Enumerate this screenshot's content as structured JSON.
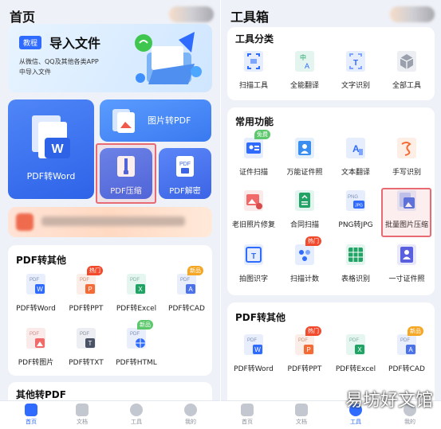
{
  "left": {
    "title": "首页",
    "banner": {
      "tag": "教程",
      "title": "导入文件",
      "line1": "从微信、QQ及其他各类APP",
      "line2": "中导入文件"
    },
    "big_tiles": {
      "pdf_word": "PDF转Word",
      "img_pdf": "图片转PDF",
      "pdf_compress": "PDF压缩",
      "pdf_decrypt": "PDF解密"
    },
    "section_title": "PDF转其他",
    "items": [
      {
        "label": "PDF转Word",
        "icon": "pdf-word-icon",
        "badge": ""
      },
      {
        "label": "PDF转PPT",
        "icon": "pdf-ppt-icon",
        "badge": "热门"
      },
      {
        "label": "PDF转Excel",
        "icon": "pdf-excel-icon",
        "badge": ""
      },
      {
        "label": "PDF转CAD",
        "icon": "pdf-cad-icon",
        "badge": "新品"
      },
      {
        "label": "PDF转图片",
        "icon": "pdf-image-icon",
        "badge": ""
      },
      {
        "label": "PDF转TXT",
        "icon": "pdf-txt-icon",
        "badge": ""
      },
      {
        "label": "PDF转HTML",
        "icon": "pdf-html-icon",
        "badge": "新品"
      }
    ],
    "next_section_title": "其他转PDF",
    "nav": [
      "首页",
      "文档",
      "工具",
      "我的"
    ]
  },
  "right": {
    "title": "工具箱",
    "cat_title": "工具分类",
    "cats": [
      {
        "label": "扫描工具",
        "icon": "scan-icon"
      },
      {
        "label": "全能翻译",
        "icon": "translate-icon"
      },
      {
        "label": "文字识别",
        "icon": "text-recognize-icon"
      },
      {
        "label": "全部工具",
        "icon": "all-tools-icon"
      }
    ],
    "common_title": "常用功能",
    "common": [
      {
        "label": "证件扫描",
        "icon": "id-scan-icon",
        "badge": "免费"
      },
      {
        "label": "万能证件照",
        "icon": "id-photo-icon",
        "badge": ""
      },
      {
        "label": "文本翻译",
        "icon": "text-translate-icon",
        "badge": ""
      },
      {
        "label": "手写识别",
        "icon": "handwriting-icon",
        "badge": ""
      },
      {
        "label": "老旧照片修复",
        "icon": "photo-repair-icon",
        "badge": ""
      },
      {
        "label": "合同扫描",
        "icon": "contract-scan-icon",
        "badge": ""
      },
      {
        "label": "PNG转JPG",
        "icon": "png-jpg-icon",
        "badge": ""
      },
      {
        "label": "批量图片压缩",
        "icon": "batch-compress-icon",
        "badge": ""
      },
      {
        "label": "拍图识字",
        "icon": "photo-ocr-icon",
        "badge": ""
      },
      {
        "label": "扫描计数",
        "icon": "scan-count-icon",
        "badge": "热门"
      },
      {
        "label": "表格识别",
        "icon": "table-recognize-icon",
        "badge": ""
      },
      {
        "label": "一寸证件照",
        "icon": "one-inch-photo-icon",
        "badge": ""
      }
    ],
    "pdf_title": "PDF转其他",
    "pdf_items": [
      {
        "label": "PDF转Word",
        "icon": "pdf-word-icon",
        "badge": ""
      },
      {
        "label": "PDF转PPT",
        "icon": "pdf-ppt-icon",
        "badge": "热门"
      },
      {
        "label": "PDF转Excel",
        "icon": "pdf-excel-icon",
        "badge": ""
      },
      {
        "label": "PDF转CAD",
        "icon": "pdf-cad-icon",
        "badge": "新品"
      }
    ],
    "nav": [
      "首页",
      "文档",
      "工具",
      "我的"
    ],
    "watermark": "易坊好文馆"
  },
  "colors": {
    "accent": "#2f6bff",
    "highlight": "#e86b74",
    "hot": "#f14a2c",
    "new": "#f5a623"
  }
}
